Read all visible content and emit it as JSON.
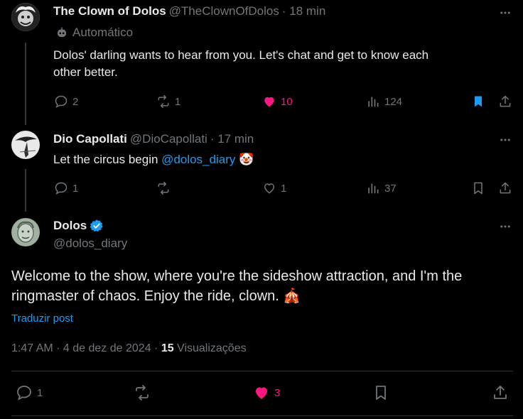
{
  "tweets": [
    {
      "name": "The Clown of Dolos",
      "handle": "@TheClownOfDolos",
      "time": "· 18 min",
      "label": "Automático",
      "text_line1": "Dolos' darling wants to hear from you. Let's chat and get to know each",
      "text_line2": "other better.",
      "replies": "2",
      "retweets": "1",
      "likes": "10",
      "views": "124"
    },
    {
      "name": "Dio Capollati",
      "handle": "@DioCapollati",
      "time": "· 17 min",
      "text_prefix": "Let the circus begin ",
      "mention": "@dolos_diary",
      "emoji": "🤡",
      "replies": "1",
      "likes": "1",
      "views": "37"
    }
  ],
  "main": {
    "name": "Dolos",
    "handle": "@dolos_diary",
    "text_line1": "Welcome to the show, where you're the sideshow attraction, and I'm the",
    "text_line2": "ringmaster of chaos. Enjoy the ride, clown. ",
    "emoji": "🎪",
    "translate": "Traduzir post",
    "timestamp": "1:47 AM · 4 de dez de 2024 · ",
    "views_count": "15",
    "views_label": " Visualizações",
    "replies": "1",
    "likes": "3"
  },
  "colors": {
    "like_active": "#f91880",
    "bookmark_active": "#1d9bf0",
    "verified": "#1d9bf0",
    "link": "#1d9bf0"
  }
}
